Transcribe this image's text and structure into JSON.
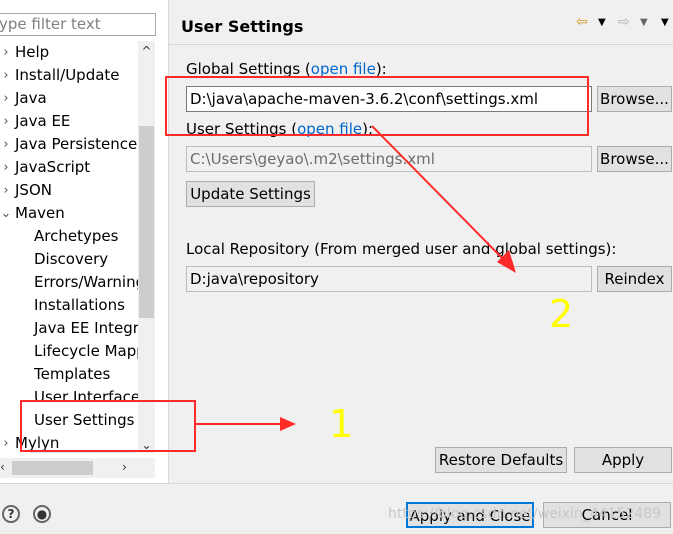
{
  "filter": {
    "placeholder": "ype filter text"
  },
  "tree": [
    {
      "label": "Help",
      "twisty": "›"
    },
    {
      "label": "Install/Update",
      "twisty": "›"
    },
    {
      "label": "Java",
      "twisty": "›"
    },
    {
      "label": "Java EE",
      "twisty": "›"
    },
    {
      "label": "Java Persistence",
      "twisty": "›"
    },
    {
      "label": "JavaScript",
      "twisty": "›"
    },
    {
      "label": "JSON",
      "twisty": "›"
    },
    {
      "label": "Maven",
      "twisty": "⌄"
    },
    {
      "label": "Archetypes",
      "child": true
    },
    {
      "label": "Discovery",
      "child": true
    },
    {
      "label": "Errors/Warnings",
      "child": true
    },
    {
      "label": "Installations",
      "child": true
    },
    {
      "label": "Java EE Integration",
      "child": true
    },
    {
      "label": "Lifecycle Mappings",
      "child": true
    },
    {
      "label": "Templates",
      "child": true
    },
    {
      "label": "User Interface",
      "child": true
    },
    {
      "label": "User Settings",
      "child": true,
      "selected": true
    },
    {
      "label": "Mylyn",
      "twisty": "›"
    }
  ],
  "page": {
    "title": "User Settings",
    "global_label": "Global Settings (",
    "global_link": "open file",
    "global_tail": "):",
    "global_value": "D:\\java\\apache-maven-3.6.2\\conf\\settings.xml",
    "browse": "Browse...",
    "user_label": "User Settings (",
    "user_link": "open file",
    "user_tail": "):",
    "user_value": "C:\\Users\\geyao\\.m2\\settings.xml",
    "update": "Update Settings",
    "local_label": "Local Repository (From merged user and global settings):",
    "local_value": "D:java\\repository",
    "reindex": "Reindex",
    "restore": "Restore Defaults",
    "apply": "Apply"
  },
  "footer": {
    "apply_close": "Apply and Close",
    "cancel": "Cancel",
    "watermark": "https://blog.csdn.net/weixin_44152489"
  },
  "annotations": {
    "n1": "1",
    "n2": "2",
    "color": "#ff2a2a",
    "num_color": "#ffff00"
  }
}
